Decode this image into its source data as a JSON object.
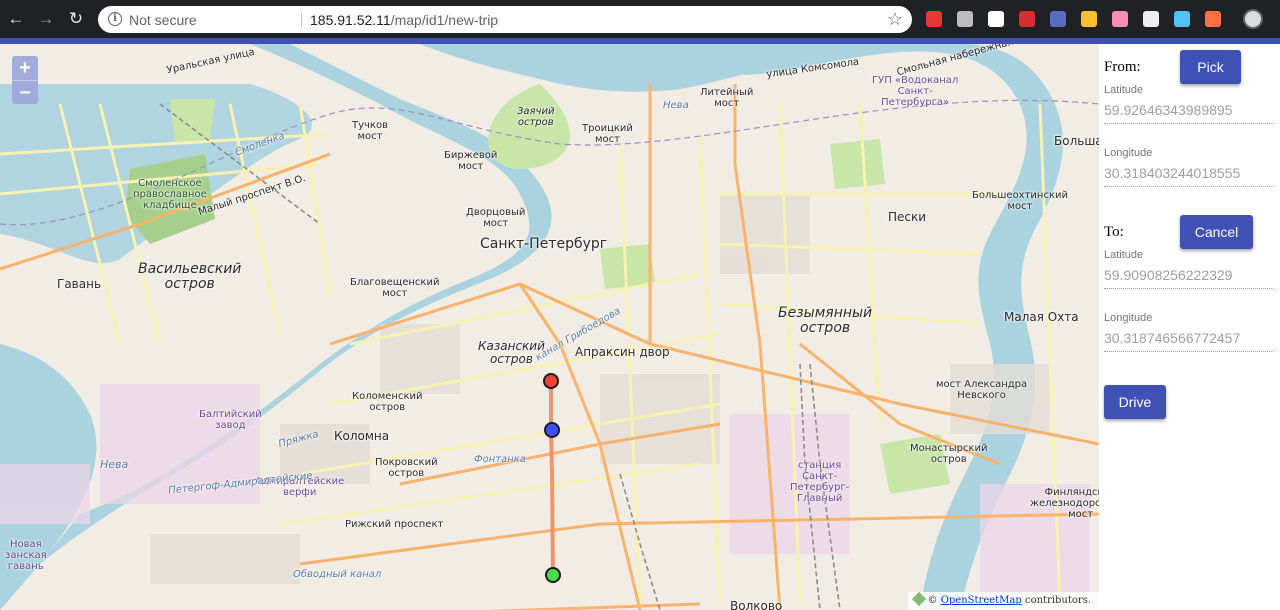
{
  "browser": {
    "security_label": "Not secure",
    "url_host": "185.91.52.11",
    "url_path": "/map/id1/new-trip",
    "info_glyph": "i",
    "back_glyph": "←",
    "forward_glyph": "→",
    "reload_glyph": "↻",
    "star_glyph": "☆",
    "extensions": [
      {
        "name": "ublock-icon",
        "color": "#e53935"
      },
      {
        "name": "vpn-icon",
        "color": "#bdbdbd"
      },
      {
        "name": "jetbrains-icon",
        "color": "#ffffff"
      },
      {
        "name": "pdf-icon",
        "color": "#d32f2f"
      },
      {
        "name": "hex-icon",
        "color": "#5c6bc0"
      },
      {
        "name": "timer-icon",
        "color": "#fbc02d"
      },
      {
        "name": "gradient-icon",
        "color": "#f48fb1"
      },
      {
        "name": "grid-icon",
        "color": "#eeeeee"
      },
      {
        "name": "cube-icon",
        "color": "#4fc3f7"
      },
      {
        "name": "fire-icon",
        "color": "#ff7043"
      }
    ]
  },
  "map": {
    "zoom_in": "+",
    "zoom_out": "−",
    "attribution_prefix": "©",
    "attribution_link": "OpenStreetMap",
    "attribution_suffix": "contributors.",
    "labels": {
      "vasilyevsky": "Васильевский\nостров",
      "gavan": "Гавань",
      "spb": "Санкт-Петербург",
      "kazansky": "Казанский\nостров",
      "apraksin": "Апраксин двор",
      "kolomna": "Коломна",
      "kolomensky": "Коломенский\nостров",
      "pokrovsky": "Покровский\nостров",
      "admiralteyskie": "Адмиралтейские\nверфи",
      "baltiysky": "Балтийский\nзавод",
      "neva_bottom": "Нева",
      "bezymyanny": "Безымянный\nостров",
      "peski": "Пески",
      "malaya_okhta": "Малая Охта",
      "most_aleksandra": "мост Александра\nНевского",
      "monastyrsky": "Монастырский\nостров",
      "finlyandsky": "Финляндский\nжелезнодорожный\nмост",
      "liteyny": "Литейный\nмост",
      "troitsky": "Троицкий\nмост",
      "birzhevoy": "Биржевой\nмост",
      "tuchkov": "Тучков\nмост",
      "dvortsovy": "Дворцовый\nмост",
      "blagoveshchensky": "Благовещенский\nмост",
      "zayachy": "Заячий\nостров",
      "smolenskoe": "Смоленское\nправославное\nкладбище",
      "bolsheokhtinsky": "Большеохтинский\nмост",
      "vodokanal": "ГУП «Водоканал\nСанкт-\nПетербурга»",
      "stantsiya": "станция\nСанкт-\nПетербург-\nГлавный",
      "novaya_gavan": "Новая\nзанская\nгавань",
      "bolsha": "Больша",
      "ryzhsky": "Рижский проспект",
      "obvodny": "Обводный канал",
      "volkovo": "Волково",
      "fontanka": "Фонтанка",
      "neva_top": "Нева",
      "smolenka": "Смоленка",
      "uralskaya": "Уральская улица",
      "komsomola": "улица Комсомола",
      "kanal_griboedova": "канал Грибоедова",
      "petergof": "Петергоф-Адмиралтейские",
      "pryazhka": "Пряжка",
      "maly_prospekt": "Малый проспект В.О.",
      "smolnaya": "Смольная набережная"
    },
    "markers": [
      {
        "name": "start-marker",
        "color": "#f44336"
      },
      {
        "name": "waypoint-marker",
        "color": "#3f51ff"
      },
      {
        "name": "end-marker",
        "color": "#4cd94c"
      }
    ]
  },
  "panel": {
    "from_label": "From:",
    "pick_button": "Pick",
    "from_latitude_label": "Latitude",
    "from_latitude_value": "59.92646343989895",
    "from_longitude_label": "Longitude",
    "from_longitude_value": "30.318403244018555",
    "to_label": "To:",
    "cancel_button": "Cancel",
    "to_latitude_label": "Latitude",
    "to_latitude_value": "59.90908256222329",
    "to_longitude_label": "Longitude",
    "to_longitude_value": "30.318746566772457",
    "drive_button": "Drive"
  },
  "colors": {
    "accent": "#3f51b5",
    "water": "#aad3df",
    "park": "#c8e6a8",
    "land": "#f1ece4",
    "road_major": "#f9b36b",
    "road_minor": "#f7f2b1",
    "route": "#f08a5d"
  }
}
